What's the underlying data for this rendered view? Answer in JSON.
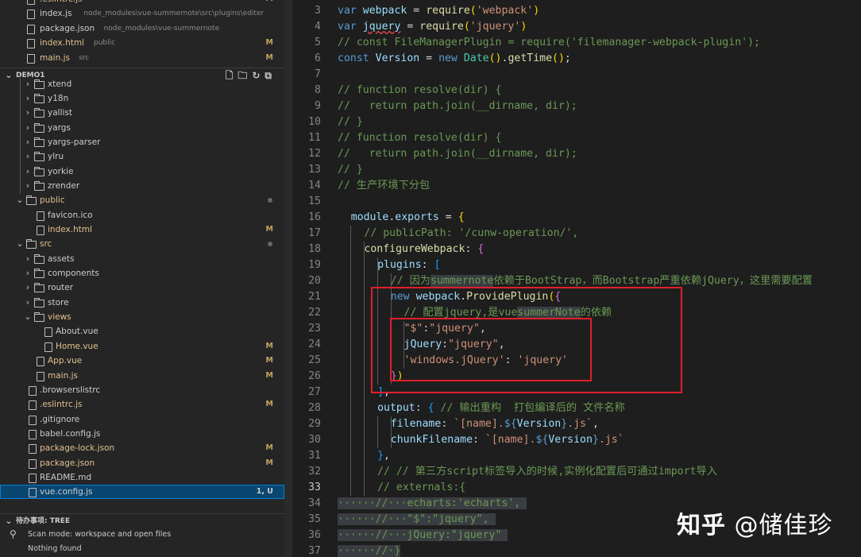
{
  "explorer": {
    "open_editors": [
      {
        "label": ".eslintrc.js",
        "desc": "",
        "badge": "M"
      },
      {
        "label": "index.js",
        "desc": "node_modules\\vue-summernote\\src\\plugins\\editer",
        "badge": ""
      },
      {
        "label": "package.json",
        "desc": "node_modules\\vue-summernote",
        "badge": ""
      },
      {
        "label": "index.html",
        "desc": "public",
        "badge": "M"
      },
      {
        "label": "main.js",
        "desc": "src",
        "badge": "M"
      }
    ],
    "project_title": "DEMO1",
    "tree": [
      {
        "label": "xtend",
        "type": "folder",
        "depth": 1,
        "open": false,
        "badge": "",
        "dot": false
      },
      {
        "label": "y18n",
        "type": "folder",
        "depth": 1,
        "open": false,
        "badge": "",
        "dot": false
      },
      {
        "label": "yallist",
        "type": "folder",
        "depth": 1,
        "open": false,
        "badge": "",
        "dot": false
      },
      {
        "label": "yargs",
        "type": "folder",
        "depth": 1,
        "open": false,
        "badge": "",
        "dot": false
      },
      {
        "label": "yargs-parser",
        "type": "folder",
        "depth": 1,
        "open": false,
        "badge": "",
        "dot": false
      },
      {
        "label": "ylru",
        "type": "folder",
        "depth": 1,
        "open": false,
        "badge": "",
        "dot": false
      },
      {
        "label": "yorkie",
        "type": "folder",
        "depth": 1,
        "open": false,
        "badge": "",
        "dot": false
      },
      {
        "label": "zrender",
        "type": "folder",
        "depth": 1,
        "open": false,
        "badge": "",
        "dot": false
      },
      {
        "label": "public",
        "type": "folder",
        "depth": 0,
        "open": true,
        "badge": "",
        "dot": true,
        "gold": true
      },
      {
        "label": "favicon.ico",
        "type": "file",
        "depth": 1,
        "open": false,
        "badge": "",
        "dot": false
      },
      {
        "label": "index.html",
        "type": "file",
        "depth": 1,
        "open": false,
        "badge": "M",
        "dot": false,
        "gold": true
      },
      {
        "label": "src",
        "type": "folder",
        "depth": 0,
        "open": true,
        "badge": "",
        "dot": true,
        "gold": true
      },
      {
        "label": "assets",
        "type": "folder",
        "depth": 1,
        "open": false,
        "badge": "",
        "dot": false
      },
      {
        "label": "components",
        "type": "folder",
        "depth": 1,
        "open": false,
        "badge": "",
        "dot": false
      },
      {
        "label": "router",
        "type": "folder",
        "depth": 1,
        "open": false,
        "badge": "",
        "dot": false
      },
      {
        "label": "store",
        "type": "folder",
        "depth": 1,
        "open": false,
        "badge": "",
        "dot": false
      },
      {
        "label": "views",
        "type": "folder",
        "depth": 1,
        "open": true,
        "badge": "",
        "dot": false,
        "gold": true
      },
      {
        "label": "About.vue",
        "type": "file",
        "depth": 2,
        "open": false,
        "badge": "",
        "dot": false
      },
      {
        "label": "Home.vue",
        "type": "file",
        "depth": 2,
        "open": false,
        "badge": "M",
        "dot": false,
        "gold": true
      },
      {
        "label": "App.vue",
        "type": "file",
        "depth": 1,
        "open": false,
        "badge": "M",
        "dot": false,
        "gold": true
      },
      {
        "label": "main.js",
        "type": "file",
        "depth": 1,
        "open": false,
        "badge": "M",
        "dot": false,
        "gold": true
      },
      {
        "label": ".browserslistrc",
        "type": "file",
        "depth": 0,
        "open": false,
        "badge": "",
        "dot": false
      },
      {
        "label": ".eslintrc.js",
        "type": "file",
        "depth": 0,
        "open": false,
        "badge": "M",
        "dot": false,
        "gold": true
      },
      {
        "label": ".gitignore",
        "type": "file",
        "depth": 0,
        "open": false,
        "badge": "",
        "dot": false
      },
      {
        "label": "babel.config.js",
        "type": "file",
        "depth": 0,
        "open": false,
        "badge": "",
        "dot": false
      },
      {
        "label": "package-lock.json",
        "type": "file",
        "depth": 0,
        "open": false,
        "badge": "M",
        "dot": false,
        "gold": true
      },
      {
        "label": "package.json",
        "type": "file",
        "depth": 0,
        "open": false,
        "badge": "M",
        "dot": false,
        "gold": true
      },
      {
        "label": "README.md",
        "type": "file",
        "depth": 0,
        "open": false,
        "badge": "",
        "dot": false
      },
      {
        "label": "vue.config.js",
        "type": "file",
        "depth": 0,
        "open": false,
        "badge": "1, U",
        "dot": false,
        "selected": true
      }
    ],
    "todo_title": "待办事项: TREE",
    "todo_items": [
      "Scan mode: workspace and open files",
      "Nothing found"
    ]
  },
  "editor": {
    "current_line": 33,
    "lines": [
      {
        "n": 3,
        "indent": 0,
        "html": "<span class=\"kw\">var</span> <span class=\"vr\">webpack</span> = <span class=\"fn\">require</span><span class=\"br1\">(</span><span class=\"str\">'webpack'</span><span class=\"br1\">)</span>"
      },
      {
        "n": 4,
        "indent": 0,
        "html": "<span class=\"kw\">var</span> <span class=\"vr sq\">jquery</span> = <span class=\"fn\">require</span><span class=\"br1\">(</span><span class=\"str\">'jquery'</span><span class=\"br1\">)</span>"
      },
      {
        "n": 5,
        "indent": 0,
        "html": "<span class=\"cmt\">// const FileManagerPlugin = require('filemanager-webpack-plugin');</span>"
      },
      {
        "n": 6,
        "indent": 0,
        "html": "<span class=\"kw\">const</span> <span class=\"vr\">Version</span> = <span class=\"kw\">new</span> <span class=\"cls\">Date</span><span class=\"br1\">()</span>.<span class=\"fn\">getTime</span><span class=\"br1\">()</span>;"
      },
      {
        "n": 7,
        "indent": 0,
        "html": ""
      },
      {
        "n": 8,
        "indent": 0,
        "html": "<span class=\"cmt\">// function resolve(dir) {</span>"
      },
      {
        "n": 9,
        "indent": 0,
        "html": "<span class=\"cmt\">//   return path.join(__dirname, dir);</span>"
      },
      {
        "n": 10,
        "indent": 0,
        "html": "<span class=\"cmt\">// }</span>"
      },
      {
        "n": 11,
        "indent": 0,
        "html": "<span class=\"cmt\">// function resolve(dir) {</span>"
      },
      {
        "n": 12,
        "indent": 0,
        "html": "<span class=\"cmt\">//   return path.join(__dirname, dir);</span>"
      },
      {
        "n": 13,
        "indent": 0,
        "html": "<span class=\"cmt\">// }</span>"
      },
      {
        "n": 14,
        "indent": 0,
        "html": "<span class=\"cmt\">// 生产环境下分包</span>"
      },
      {
        "n": 15,
        "indent": 0,
        "html": ""
      },
      {
        "n": 16,
        "indent": 2,
        "html": "<span class=\"vr\">module</span>.<span class=\"vr\">exports</span> = <span class=\"br1\">{</span>"
      },
      {
        "n": 17,
        "indent": 4,
        "html": "<span class=\"cmt\">// publicPath: '/cunw-operation/',</span>"
      },
      {
        "n": 18,
        "indent": 4,
        "html": "<span class=\"fn\">configureWebpack</span>: <span class=\"br2\">{</span>"
      },
      {
        "n": 19,
        "indent": 6,
        "html": "<span class=\"vr\">plugins</span>: <span class=\"br3\">[</span>"
      },
      {
        "n": 20,
        "indent": 8,
        "html": "<span class=\"cmt\">// 因为<span class=\"seltext\">summernote</span>依赖于BootStrap，而Bootstrap严重依赖jQuery，这里需要配置</span>"
      },
      {
        "n": 21,
        "indent": 8,
        "html": "<span class=\"kw\">new</span> <span class=\"vr\">webpack</span>.<span class=\"fn\">ProvidePlugin</span><span class=\"br1\">(</span><span class=\"br2\">{</span>"
      },
      {
        "n": 22,
        "indent": 10,
        "html": "<span class=\"cmt\">// 配置jquery,是vue<span class=\"seltext\">summerNote</span>的依赖</span>"
      },
      {
        "n": 23,
        "indent": 10,
        "html": "<span class=\"str\">\"$\"</span>:<span class=\"str\">\"jquery\"</span>,"
      },
      {
        "n": 24,
        "indent": 10,
        "html": "<span class=\"vr\">jQuery</span>:<span class=\"str\">\"jquery\"</span>,"
      },
      {
        "n": 25,
        "indent": 10,
        "html": "<span class=\"str\">'windows.jQuery'</span>: <span class=\"str\">'jquery'</span>"
      },
      {
        "n": 26,
        "indent": 8,
        "html": "<span class=\"br2\">}</span><span class=\"br1\">)</span>"
      },
      {
        "n": 27,
        "indent": 6,
        "html": "<span class=\"br3\">]</span>,"
      },
      {
        "n": 28,
        "indent": 6,
        "html": "<span class=\"vr\">output</span>: <span class=\"br3\">{</span> <span class=\"cmt\">// 输出重构  打包编译后的 文件名称</span>"
      },
      {
        "n": 29,
        "indent": 8,
        "html": "<span class=\"vr\">filename</span>: <span class=\"str\">`[name].</span><span class=\"tpl\">${</span><span class=\"vr\">Version</span><span class=\"tpl\">}</span><span class=\"str\">.js`</span>,"
      },
      {
        "n": 30,
        "indent": 8,
        "html": "<span class=\"vr\">chunkFilename</span>: <span class=\"str\">`[name].</span><span class=\"tpl\">${</span><span class=\"vr\">Version</span><span class=\"tpl\">}</span><span class=\"str\">.js`</span>"
      },
      {
        "n": 31,
        "indent": 6,
        "html": "<span class=\"br3\">}</span>,"
      },
      {
        "n": 32,
        "indent": 6,
        "html": "<span class=\"cmt\">// // 第三方script标签导入的时候,实例化配置后可通过import导入</span>"
      },
      {
        "n": 33,
        "indent": 6,
        "html": "<span class=\"cmt\">// externals:{</span>"
      },
      {
        "n": 34,
        "indent": 0,
        "html": "<span class=\"seltext\"><span class=\"cmt\">······//···echarts:'echarts',</span> </span>"
      },
      {
        "n": 35,
        "indent": 0,
        "html": "<span class=\"seltext\"><span class=\"cmt\">······//···\"$\":\"jquery\",</span> </span>"
      },
      {
        "n": 36,
        "indent": 0,
        "html": "<span class=\"seltext\"><span class=\"cmt\">······//···jQuery:\"jquery\"</span> </span>"
      },
      {
        "n": 37,
        "indent": 0,
        "html": "<span class=\"seltext\"><span class=\"cmt\">······//·}</span></span>"
      }
    ]
  },
  "watermark": {
    "brand": "知乎",
    "author": "@储佳珍"
  },
  "colors": {
    "highlight_box": "#e0202a",
    "modified_badge": "#c5a45e",
    "selection": "#094771"
  }
}
